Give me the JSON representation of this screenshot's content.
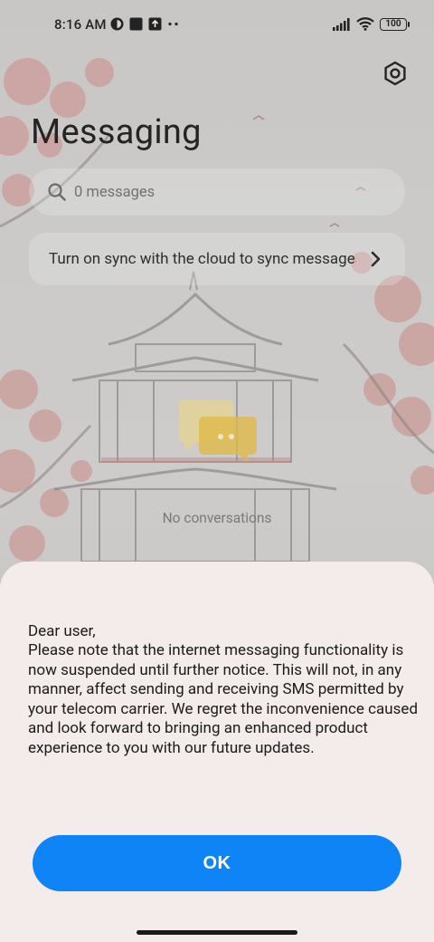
{
  "status_bar": {
    "time": "8:16 AM",
    "battery": "100",
    "left_icons": [
      "vpn-icon",
      "app-notification-icon",
      "upload-icon",
      "more-dots-icon"
    ],
    "right_icons": [
      "signal-icon",
      "wifi-icon",
      "battery-icon"
    ]
  },
  "header": {
    "title": "Messaging",
    "settings_icon": "settings-hexagon-icon"
  },
  "search": {
    "placeholder": "0 messages"
  },
  "sync_banner": {
    "text": "Turn on sync with the cloud to sync messages"
  },
  "empty_state": {
    "label": "No conversations",
    "icon": "chat-bubbles-icon"
  },
  "dialog": {
    "greeting": "Dear user,",
    "body": "Please note that the internet messaging functionality is now suspended until further notice. This will not, in any manner, affect sending and receiving SMS permitted by your telecom carrier. We regret the inconvenience caused and look forward to bringing an enhanced product experience to you with our future updates.",
    "ok_label": "OK"
  },
  "colors": {
    "accent": "#0e84f7",
    "sheet_background": "#f4ecea",
    "chat_icon_back": "#f3e0a0",
    "chat_icon_front": "#f1c44a"
  }
}
